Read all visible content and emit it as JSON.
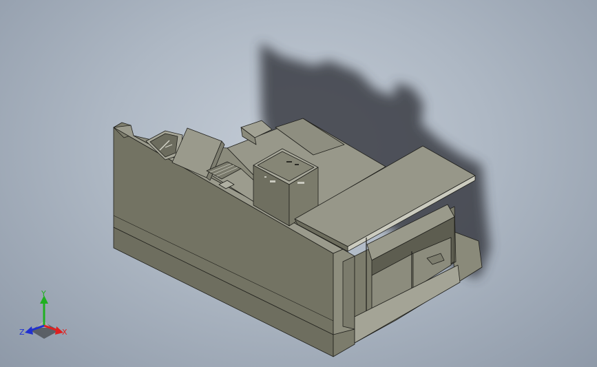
{
  "triad": {
    "x_label": "X",
    "y_label": "Y",
    "z_label": "Z",
    "x_color": "#e02020",
    "y_color": "#20b020",
    "z_color": "#2030d0"
  },
  "scene": {
    "model": "3d-assembly-model",
    "colors": {
      "face_front": "#737363",
      "face_side": "#878777",
      "face_top": "#98988a",
      "shadow": "#3a3d44",
      "edge": "#1e1e1a"
    }
  }
}
